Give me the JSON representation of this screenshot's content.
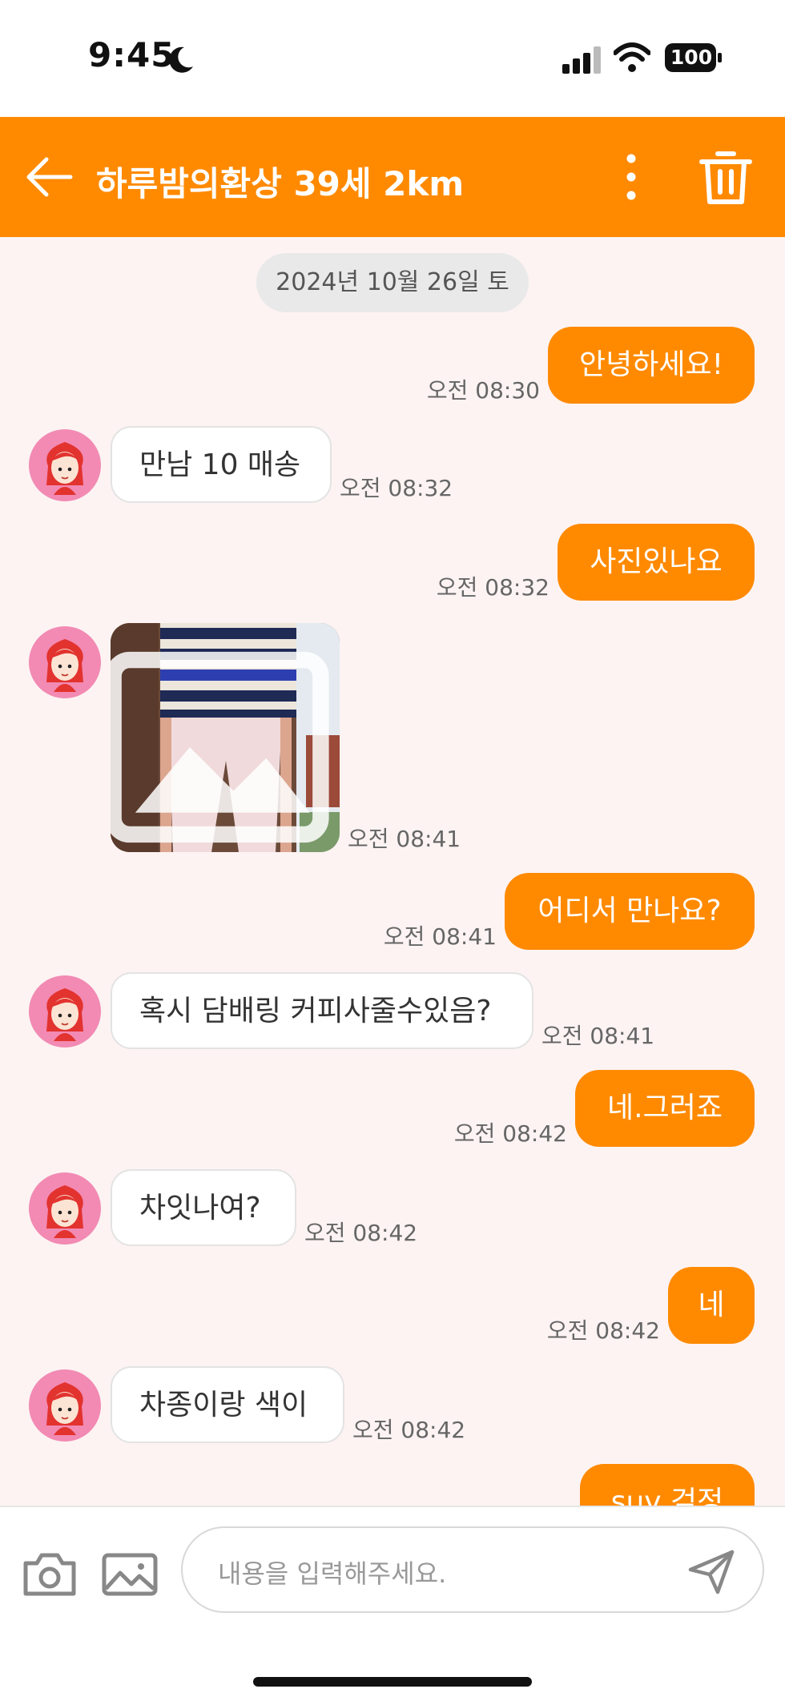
{
  "status_bar": {
    "time": "9:45",
    "battery": "100"
  },
  "header": {
    "title": "하루밤의환상 39세 2km"
  },
  "chat": {
    "date": "2024년 10월 26일 토",
    "messages": [
      {
        "from": "me",
        "text": "안녕하세요!",
        "time": "오전 08:30"
      },
      {
        "from": "them",
        "text": "만남 10 매송",
        "time": "오전 08:32"
      },
      {
        "from": "me",
        "text": "사진있나요",
        "time": "오전 08:32"
      },
      {
        "from": "them",
        "type": "image",
        "time": "오전 08:41"
      },
      {
        "from": "me",
        "text": "어디서 만나요?",
        "time": "오전 08:41"
      },
      {
        "from": "them",
        "text": "혹시 담배링 커피사줄수있음?",
        "time": "오전 08:41"
      },
      {
        "from": "me",
        "text": "네.그러죠",
        "time": "오전 08:42"
      },
      {
        "from": "them",
        "text": "차잇나여?",
        "time": "오전 08:42"
      },
      {
        "from": "me",
        "text": "네",
        "time": "오전 08:42"
      },
      {
        "from": "them",
        "text": "차종이랑 색이",
        "time": "오전 08:42"
      },
      {
        "from": "me",
        "text": "suv 검정"
      }
    ]
  },
  "input": {
    "placeholder": "내용을 입력해주세요."
  },
  "colors": {
    "accent": "#FF8A00",
    "chat_bg": "#FDF3F3",
    "avatar_bg": "#F28AB3"
  }
}
